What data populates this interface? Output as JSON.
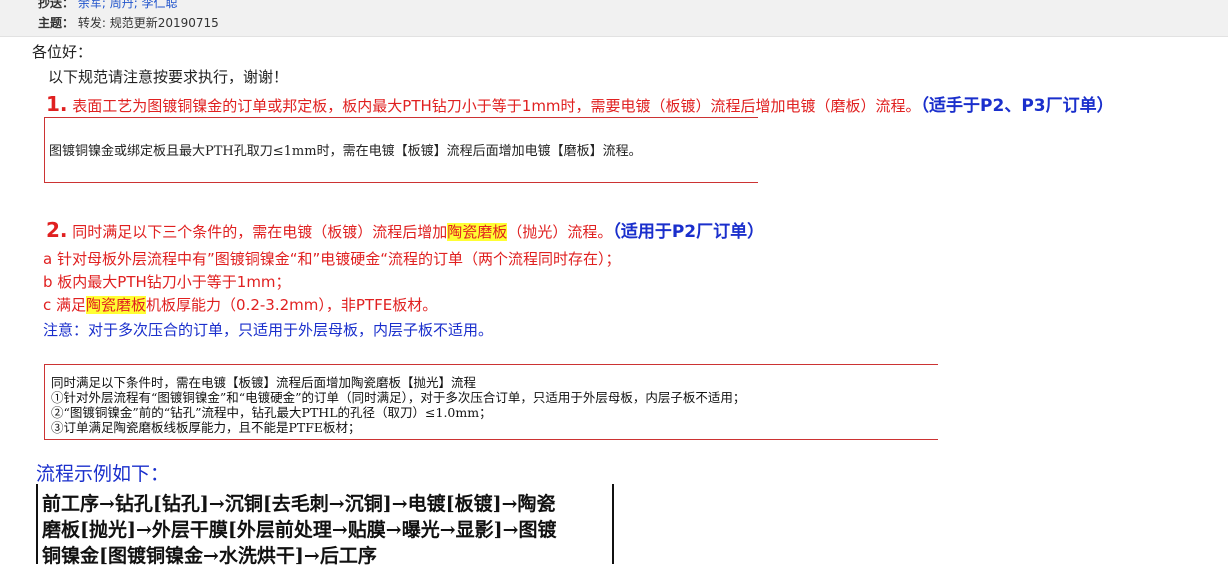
{
  "header": {
    "cc_label": "抄送：",
    "cc_names": "余军; 周丹; 李仁聪",
    "subject_label": "主题：",
    "subject_value": "转发: 规范更新20190715"
  },
  "body": {
    "greeting": "各位好：",
    "intro": "以下规范请注意按要求执行，谢谢！",
    "item1": {
      "num": "1.",
      "text": " 表面工艺为图镀铜镍金的订单或邦定板，板内最大PTH钻刀小于等于1mm时，需要电镀（板镀）流程后增加电镀（磨板）流程。",
      "note": "（适手于P2、P3厂订单）",
      "box_text": "图镀铜镍金或绑定板且最大PTH孔取刀≤1mm时，需在电镀【板镀】流程后面增加电镀【磨板】流程。"
    },
    "item2": {
      "num": "2.",
      "text_pre": " 同时满足以下三个条件的，需在电镀（板镀）流程后增加",
      "highlight": "陶瓷磨板",
      "text_post": "（抛光）流程。",
      "note": "（适用于P2厂订单）",
      "cond_a": "a  针对母板外层流程中有”图镀铜镍金“和”电镀硬金“流程的订单（两个流程同时存在）；",
      "cond_b": "b  板内最大PTH钻刀小于等于1mm；",
      "cond_c_pre": "c  满足",
      "cond_c_hl": "陶瓷磨板",
      "cond_c_post": "机板厚能力（0.2-3.2mm），非PTFE板材。",
      "remark": "注意：对于多次压合的订单，只适用于外层母板，内层子板不适用。",
      "box_lines": [
        "同时满足以下条件时，需在电镀【板镀】流程后面增加陶瓷磨板【抛光】流程",
        "①针对外层流程有“图镀铜镍金”和“电镀硬金”的订单（同时满足），对于多次压合订单，只适用于外层母板，内层子板不适用；",
        "②“图镀铜镍金”前的“钻孔”流程中，钻孔最大PTHL的孔径（取刀）≤1.0mm；",
        "③订单满足陶瓷磨板线板厚能力，且不能是PTFE板材；"
      ]
    },
    "flow_title": "流程示例如下：",
    "flow_lines": [
      "前工序→钻孔[钻孔]→沉铜[去毛刺→沉铜]→电镀[板镀]→陶瓷",
      "磨板[抛光]→外层干膜[外层前处理→贴膜→曝光→显影]→图镀",
      "铜镍金[图镀铜镍金→水洗烘干]→后工序"
    ]
  }
}
